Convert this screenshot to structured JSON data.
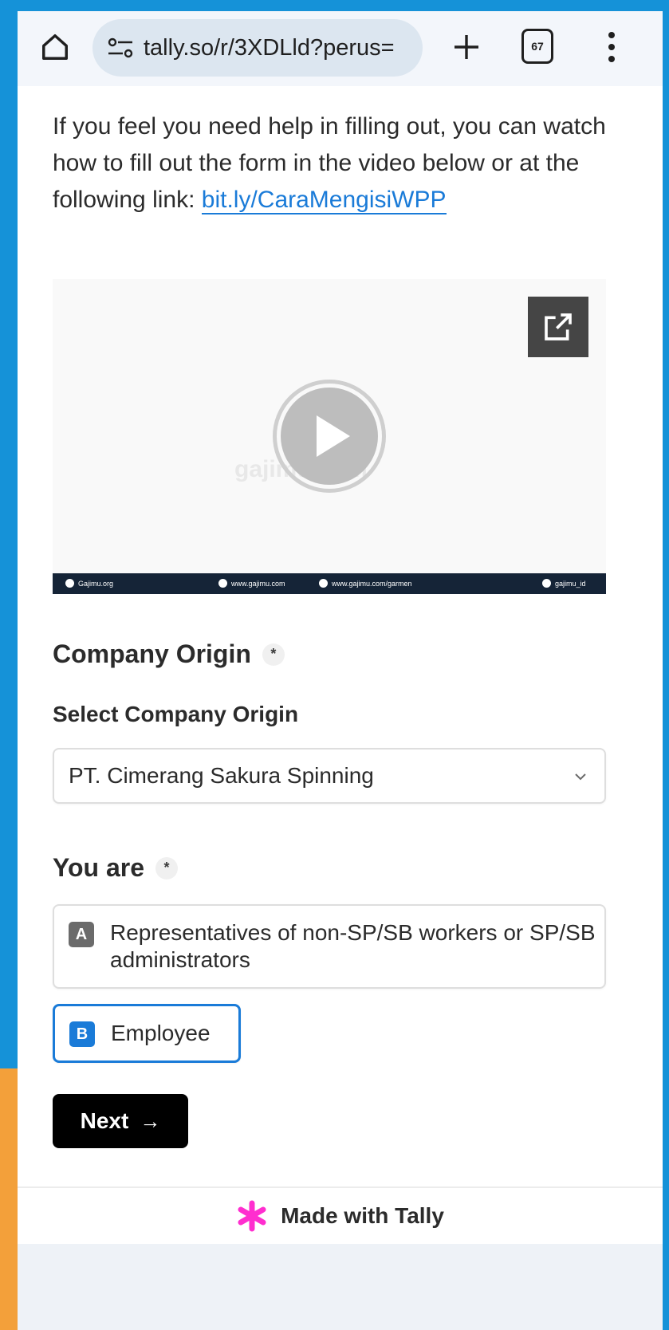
{
  "browser": {
    "url": "tally.so/r/3XDLld?perus=",
    "tab_count": "67"
  },
  "intro": {
    "text": "If you feel you need help in filling out, you can watch how to fill out the form in the video below or at the following link: ",
    "link_text": "bit.ly/CaraMengisiWPP"
  },
  "video": {
    "watermark": "gajimu.com",
    "bar": {
      "facebook": "Gajimu.org",
      "site": "www.gajimu.com",
      "site_garmen": "www.gajimu.com/garmen",
      "instagram": "gajimu_id"
    }
  },
  "company_origin": {
    "title": "Company Origin",
    "required": "*",
    "select_label": "Select Company Origin",
    "selected_value": "PT. Cimerang Sakura Spinning"
  },
  "you_are": {
    "title": "You are",
    "required": "*",
    "options": [
      {
        "key": "A",
        "label": "Representatives of non-SP/SB workers or SP/SB administrators"
      },
      {
        "key": "B",
        "label": "Employee"
      }
    ]
  },
  "next_button": {
    "label": "Next",
    "arrow": "→"
  },
  "footer": {
    "text": "Made with Tally"
  },
  "colors": {
    "accent": "#1a7bd8",
    "tally_star": "#ff2ecf",
    "frame_blue": "#1592d8",
    "frame_orange": "#f3a03a"
  }
}
